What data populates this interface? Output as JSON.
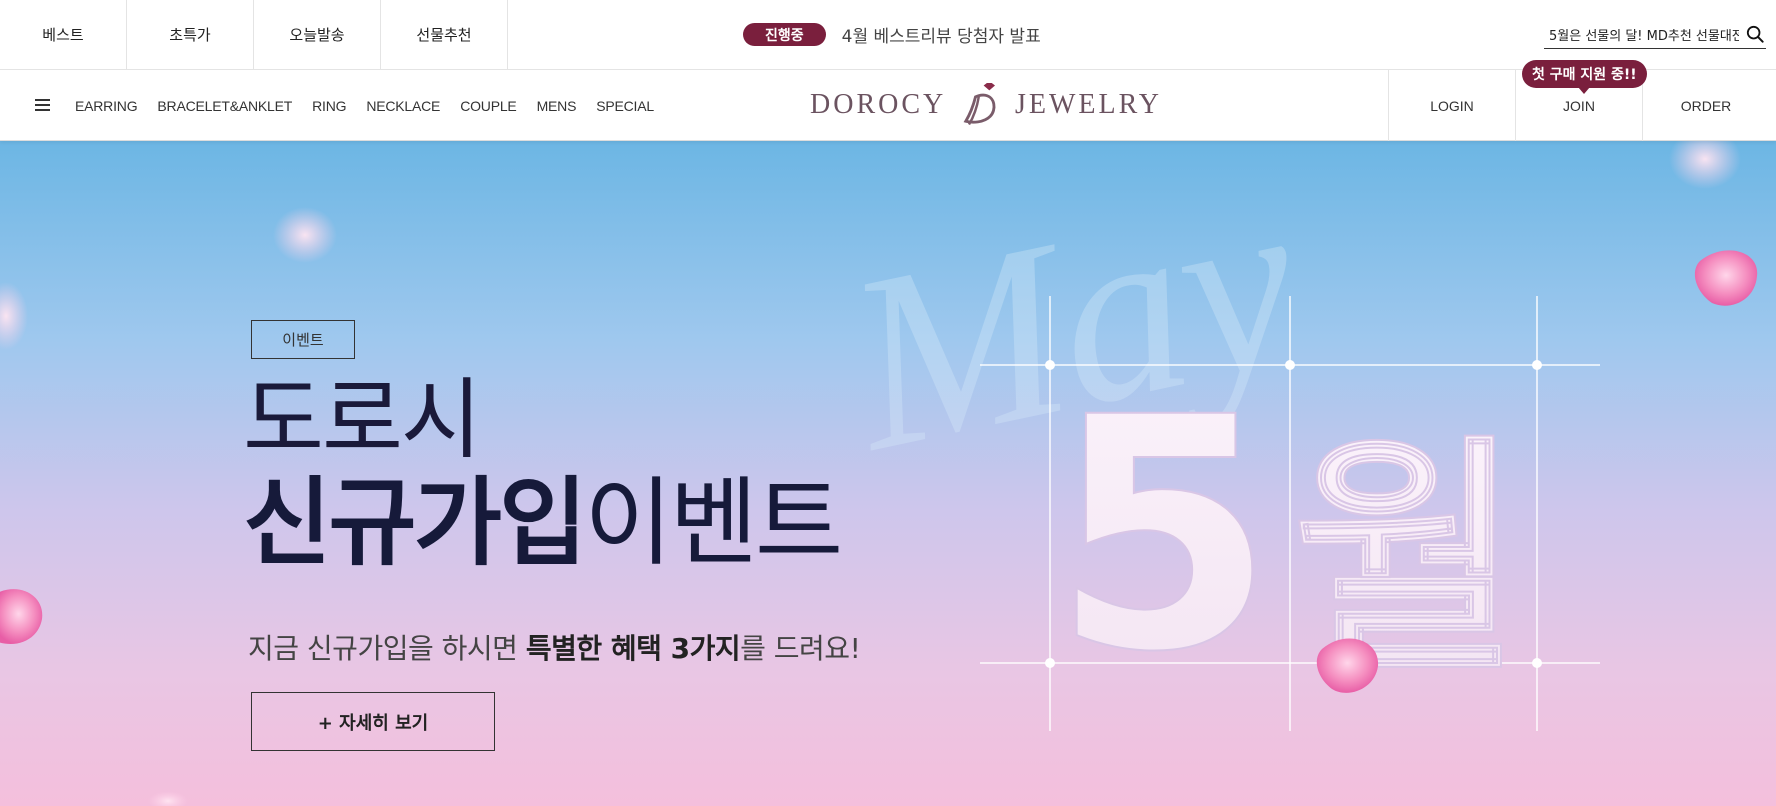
{
  "top_bar": {
    "quick_tabs": [
      {
        "label": "베스트"
      },
      {
        "label": "초특가"
      },
      {
        "label": "오늘발송"
      },
      {
        "label": "선물추천"
      }
    ],
    "notice": {
      "badge": "진행중",
      "text": "4월 베스트리뷰 당첨자 발표"
    },
    "search": {
      "value": "5월은 선물의 달! MD추천 선물대전 (",
      "icon": "search-icon"
    }
  },
  "nav": {
    "menu_icon": "hamburger-icon",
    "categories": [
      "EARRING",
      "BRACELET&ANKLET",
      "RING",
      "NECKLACE",
      "COUPLE",
      "MENS",
      "SPECIAL"
    ],
    "logo": {
      "left": "DOROCY",
      "right": "JEWELRY"
    },
    "account": [
      {
        "label": "LOGIN"
      },
      {
        "label": "JOIN"
      },
      {
        "label": "ORDER"
      }
    ],
    "join_tooltip": "첫 구매 지원 중!!"
  },
  "hero": {
    "tag": "이벤트",
    "title_line1": "도로시",
    "title_line2_bold": "신규가입",
    "title_line2_light": "이벤트",
    "subtitle_pre": "지금 신규가입을 하시면 ",
    "subtitle_bold": "특별한 혜택 3가지",
    "subtitle_post": "를 드려요!",
    "button": "+ 자세히 보기",
    "script_word": "May",
    "big_number": "5",
    "big_unit": "월"
  },
  "colors": {
    "brand": "#7a1f3d",
    "logo": "#6b5360",
    "hero_top": "#6cb6e4",
    "hero_bottom": "#f4bfdc"
  }
}
